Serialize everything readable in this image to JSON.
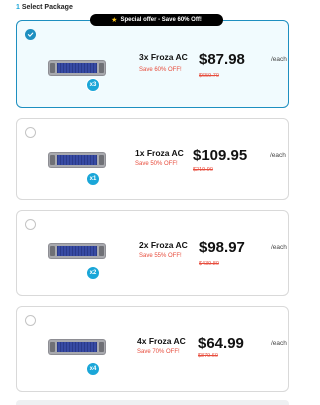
{
  "section": {
    "step": "1",
    "title": "Select Package"
  },
  "offer_badge": {
    "text": "Special offer - Save 60% Off!",
    "icon": "star-icon"
  },
  "packages": [
    {
      "name": "3x Froza AC",
      "save": "Save 60% OFF!",
      "price": "$87.98",
      "unit": "/each",
      "old_price": "$659.70",
      "qty_badge": "x3",
      "selected": true
    },
    {
      "name": "1x Froza AC",
      "save": "Save 50% OFF!",
      "price": "$109.95",
      "unit": "/each",
      "old_price": "$219.90",
      "qty_badge": "x1",
      "selected": false
    },
    {
      "name": "2x Froza AC",
      "save": "Save 55% OFF!",
      "price": "$98.97",
      "unit": "/each",
      "old_price": "$439.80",
      "qty_badge": "x2",
      "selected": false
    },
    {
      "name": "4x Froza AC",
      "save": "Save 70% OFF!",
      "price": "$64.99",
      "unit": "/each",
      "old_price": "$879.60",
      "qty_badge": "x4",
      "selected": false
    }
  ],
  "colors": {
    "accent": "#1e8fc0",
    "badge": "#1aa6d8",
    "discount": "#e74c3c",
    "selected_bg": "#f1fbfe"
  }
}
